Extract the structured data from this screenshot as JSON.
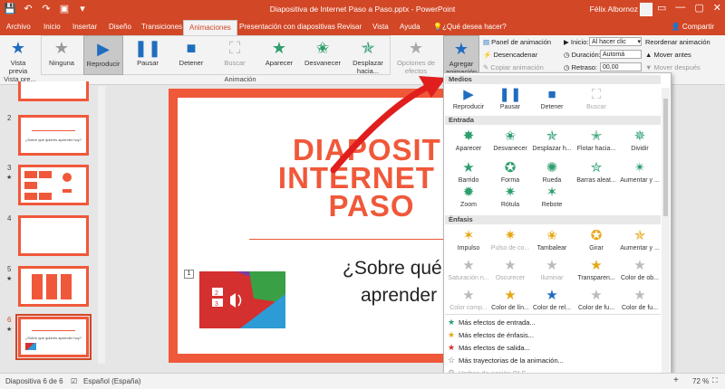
{
  "titlebar": {
    "qat": [
      "💾",
      "↶",
      "↷",
      "▣",
      "▾"
    ],
    "title": "Diapositiva de Internet Paso a Paso.pptx  -  PowerPoint",
    "user": "Félix Albornoz",
    "win": [
      "▭",
      "—",
      "▢",
      "✕"
    ]
  },
  "tabs": {
    "items": [
      "Archivo",
      "Inicio",
      "Insertar",
      "Diseño",
      "Transiciones",
      "Animaciones",
      "Presentación con diapositivas",
      "Revisar",
      "Vista",
      "Ayuda"
    ],
    "active": "Animaciones",
    "tellme": "¿Qué desea hacer?",
    "share": "Compartir"
  },
  "ribbon": {
    "vista": "Vista previa",
    "vista_group": "Vista pre...",
    "gallery": [
      "Ninguna",
      "Reproducir",
      "Pausar",
      "Detener",
      "Buscar",
      "Aparecer",
      "Desvanecer",
      "Desplazar hacia..."
    ],
    "effect_options": "Opciones de efectos",
    "group_anim": "Animación",
    "add_anim": "Agregar animación",
    "panel": "Panel de animación",
    "trigger": "Desencadenar",
    "copy": "Copiar animación",
    "start_label": "Inicio:",
    "start_value": "Al hacer clic",
    "dur_label": "Duración:",
    "dur_value": "Automá",
    "delay_label": "Retraso:",
    "delay_value": "00,00",
    "reorder": "Reordenar animación",
    "move_earlier": "Mover antes",
    "move_later": "Mover después"
  },
  "slides": [
    {
      "num": "2",
      "text": "¿Sobre qué quieres aprender hoy?"
    },
    {
      "num": "3",
      "star": "★"
    },
    {
      "num": "4"
    },
    {
      "num": "5",
      "star": "★"
    },
    {
      "num": "6",
      "star": "★",
      "text": "¿Sobre qué quieres aprender hoy?"
    }
  ],
  "slide": {
    "title": "DIAPOSITIVA DE INTERNET PASO A PASO",
    "title_l1": "DIAPOSITI",
    "title_l2": "INTERNET P",
    "title_l3": "PASO",
    "subtitle_l1": "¿Sobre qué",
    "subtitle_l2": "aprender",
    "anim_num": "1",
    "img_n1": "2",
    "img_n2": "3"
  },
  "dropdown": {
    "media_head": "Medios",
    "media": [
      "Reproducir",
      "Pausar",
      "Detener",
      "Buscar"
    ],
    "entrada_head": "Entrada",
    "entrada": [
      "Aparecer",
      "Desvanecer",
      "Desplazar h...",
      "Flotar hacia...",
      "Dividir",
      "Barrido",
      "Forma",
      "Rueda",
      "Barras aleat...",
      "Aumentar y ...",
      "Zoom",
      "Rótula",
      "Rebote"
    ],
    "enfasis_head": "Énfasis",
    "enfasis": [
      "Impulso",
      "Pulso de co...",
      "Tambalear",
      "Girar",
      "Aumentar y ...",
      "Saturación n...",
      "Oscurecer",
      "Iluminar",
      "Transparen...",
      "Color de ob...",
      "Color comp...",
      "Color de lín...",
      "Color de rel...",
      "Color de fu...",
      "Color de fu..."
    ],
    "more": [
      "Más efectos de entrada...",
      "Más efectos de énfasis...",
      "Más efectos de salida...",
      "Más trayectorias de la animación...",
      "Verbos de acción OLE..."
    ]
  },
  "status": {
    "slide": "Diapositiva 6 de 6",
    "lang": "Español (España)",
    "zoom": "72 %"
  }
}
